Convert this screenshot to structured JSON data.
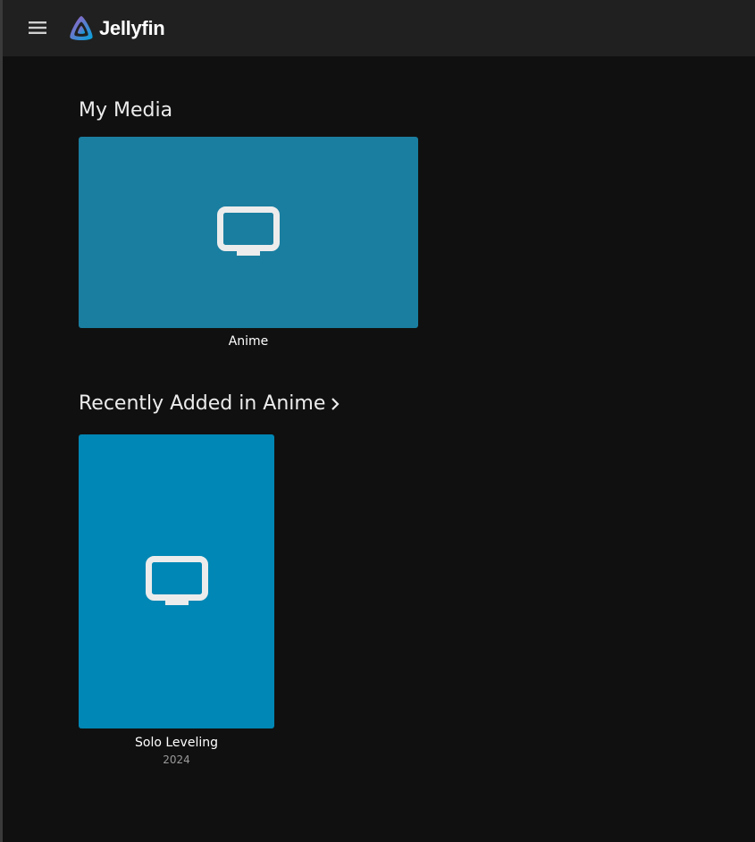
{
  "app": {
    "name": "Jellyfin",
    "brand_colors": {
      "logo_gradient_start": "#aa5cc3",
      "logo_gradient_end": "#00a4dc"
    }
  },
  "header": {
    "menu_icon": "hamburger-menu-icon"
  },
  "sections": {
    "my_media": {
      "title": "My Media",
      "items": [
        {
          "label": "Anime",
          "icon": "tv-icon",
          "color": "#1a7ea0"
        }
      ]
    },
    "recently_added": {
      "title": "Recently Added in Anime",
      "chevron_icon": "chevron-right-icon",
      "items": [
        {
          "title": "Solo Leveling",
          "year": "2024",
          "icon": "tv-icon",
          "color": "#0087b5"
        }
      ]
    }
  }
}
